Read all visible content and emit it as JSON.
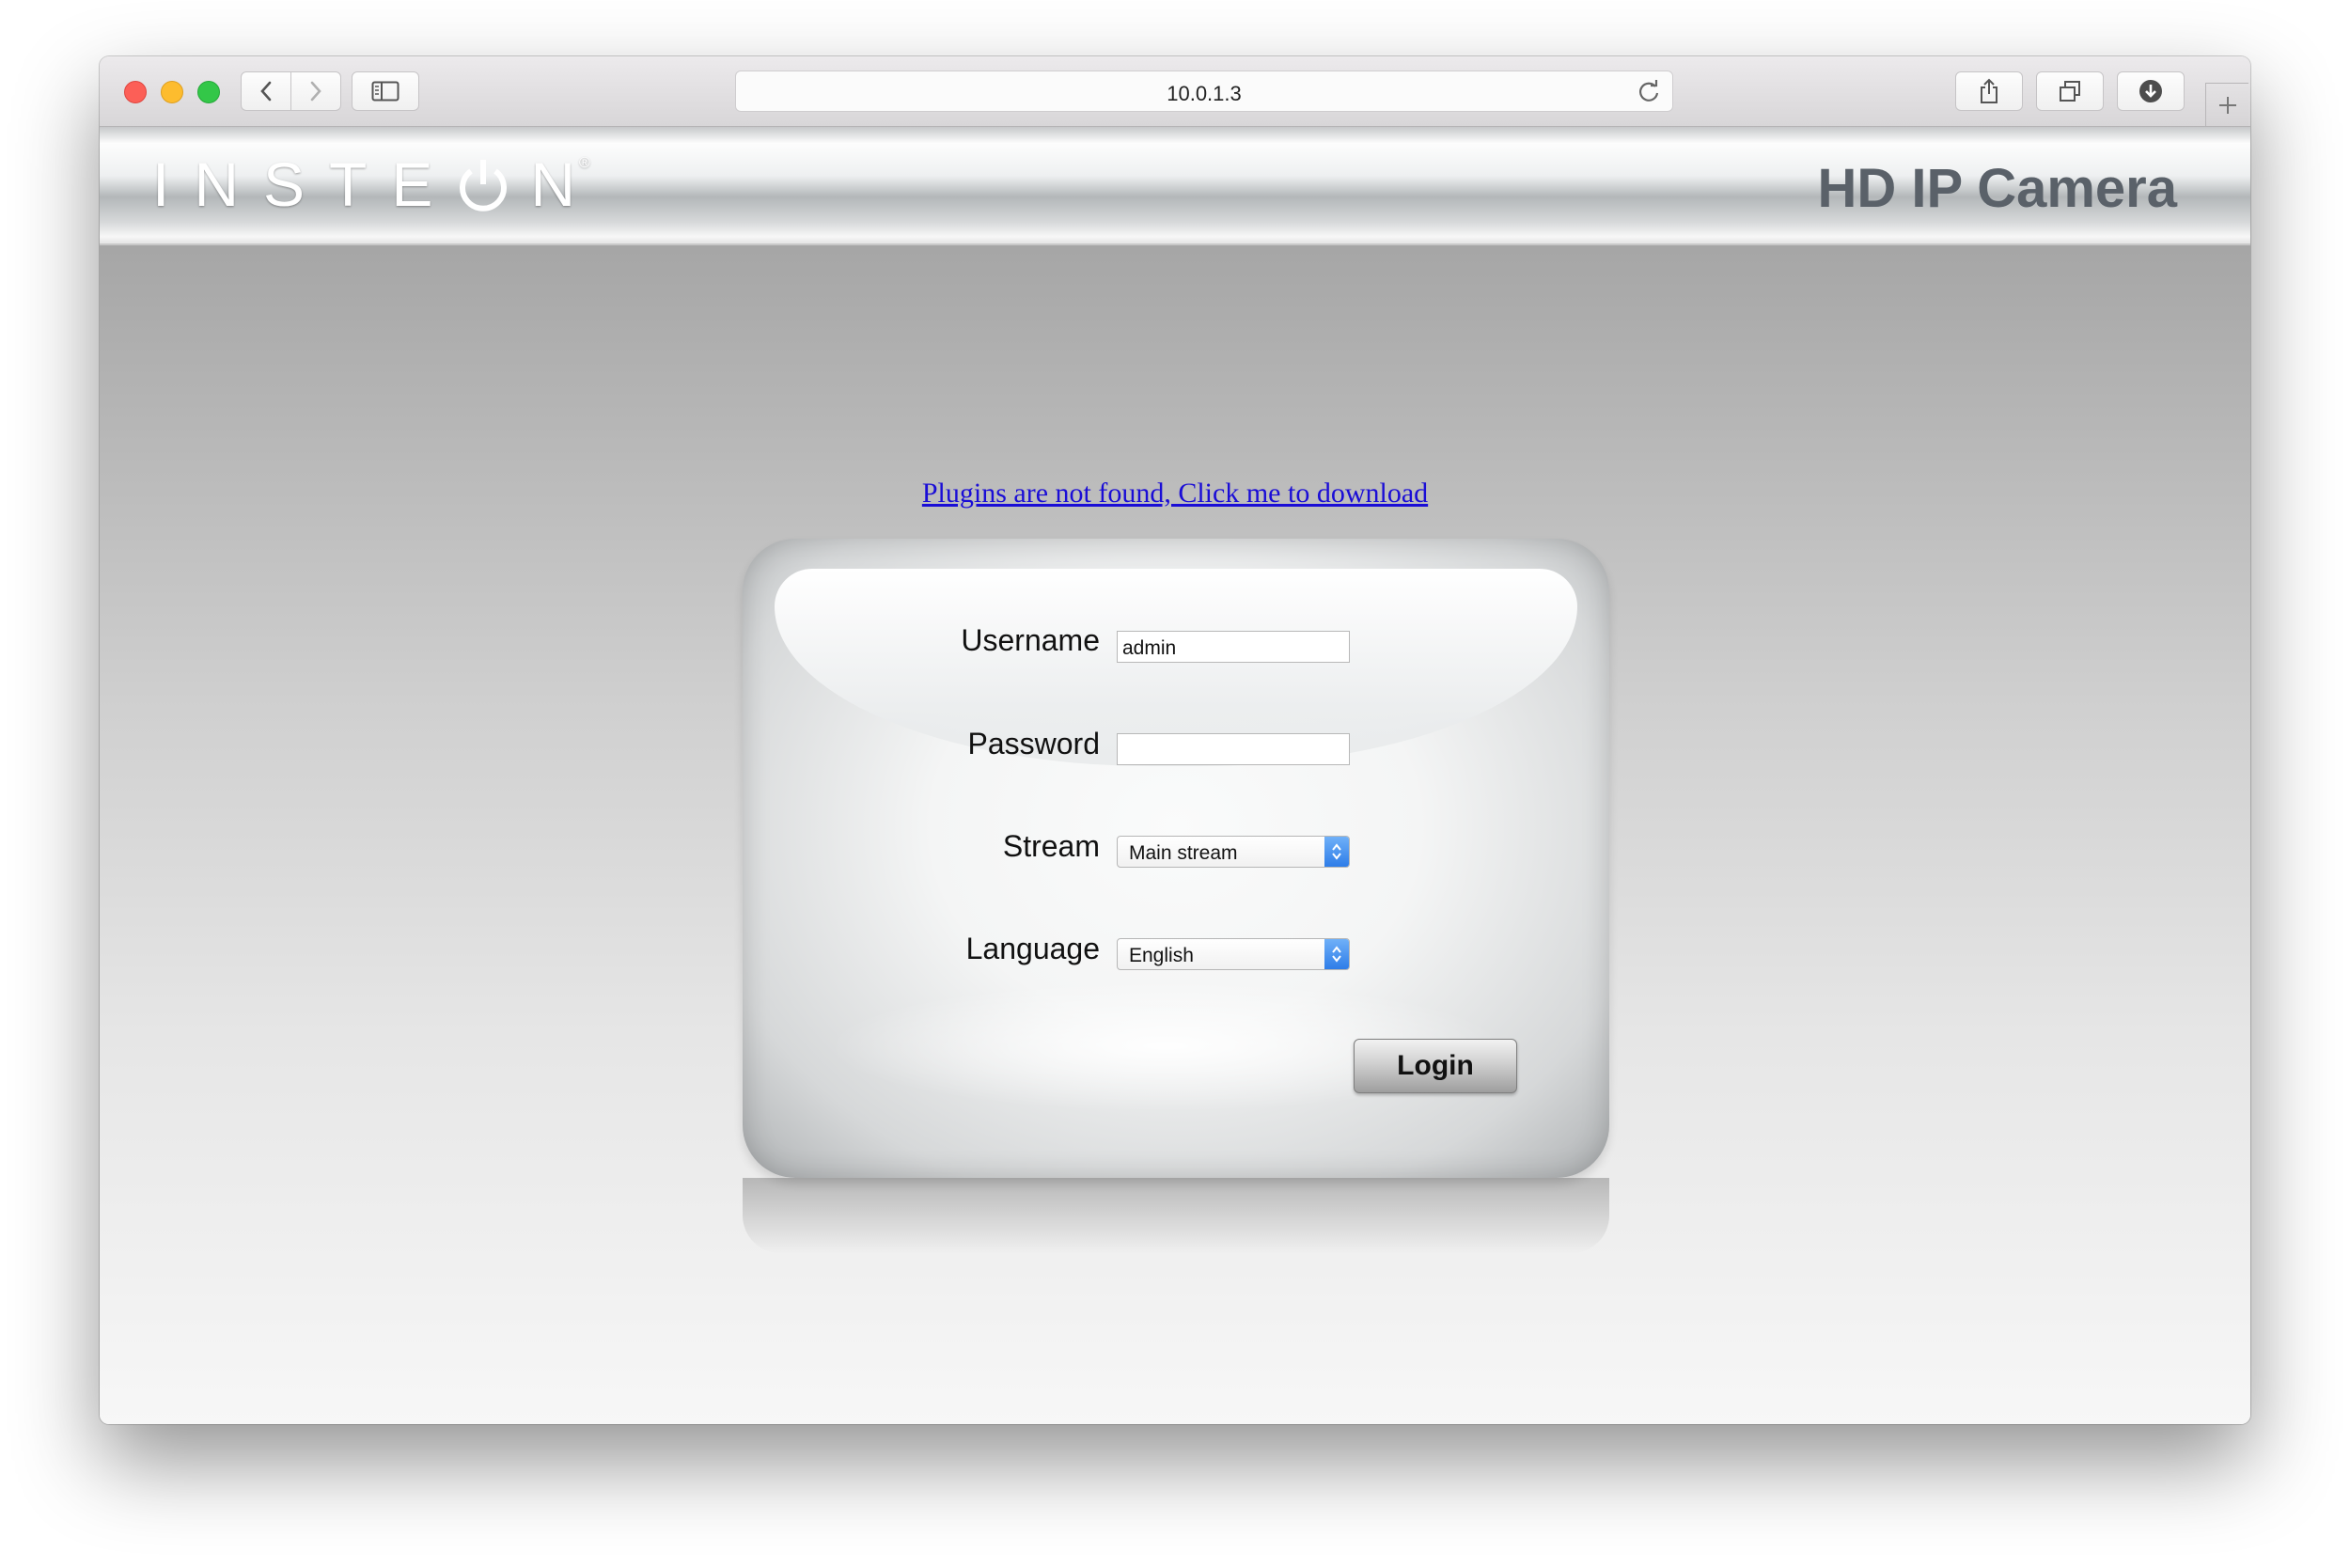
{
  "browser": {
    "url": "10.0.1.3"
  },
  "header": {
    "logo_text": "INSTEON",
    "product_name": "HD IP Camera"
  },
  "plugin_link": "Plugins are not found, Click me to download",
  "login_form": {
    "username_label": "Username",
    "username_value": "admin",
    "password_label": "Password",
    "password_value": "",
    "stream_label": "Stream",
    "stream_value": "Main stream",
    "language_label": "Language",
    "language_value": "English",
    "login_button": "Login"
  },
  "colors": {
    "link": "#1a0dd6",
    "product_name": "#5a6169",
    "select_accent": "#2e7de8"
  }
}
